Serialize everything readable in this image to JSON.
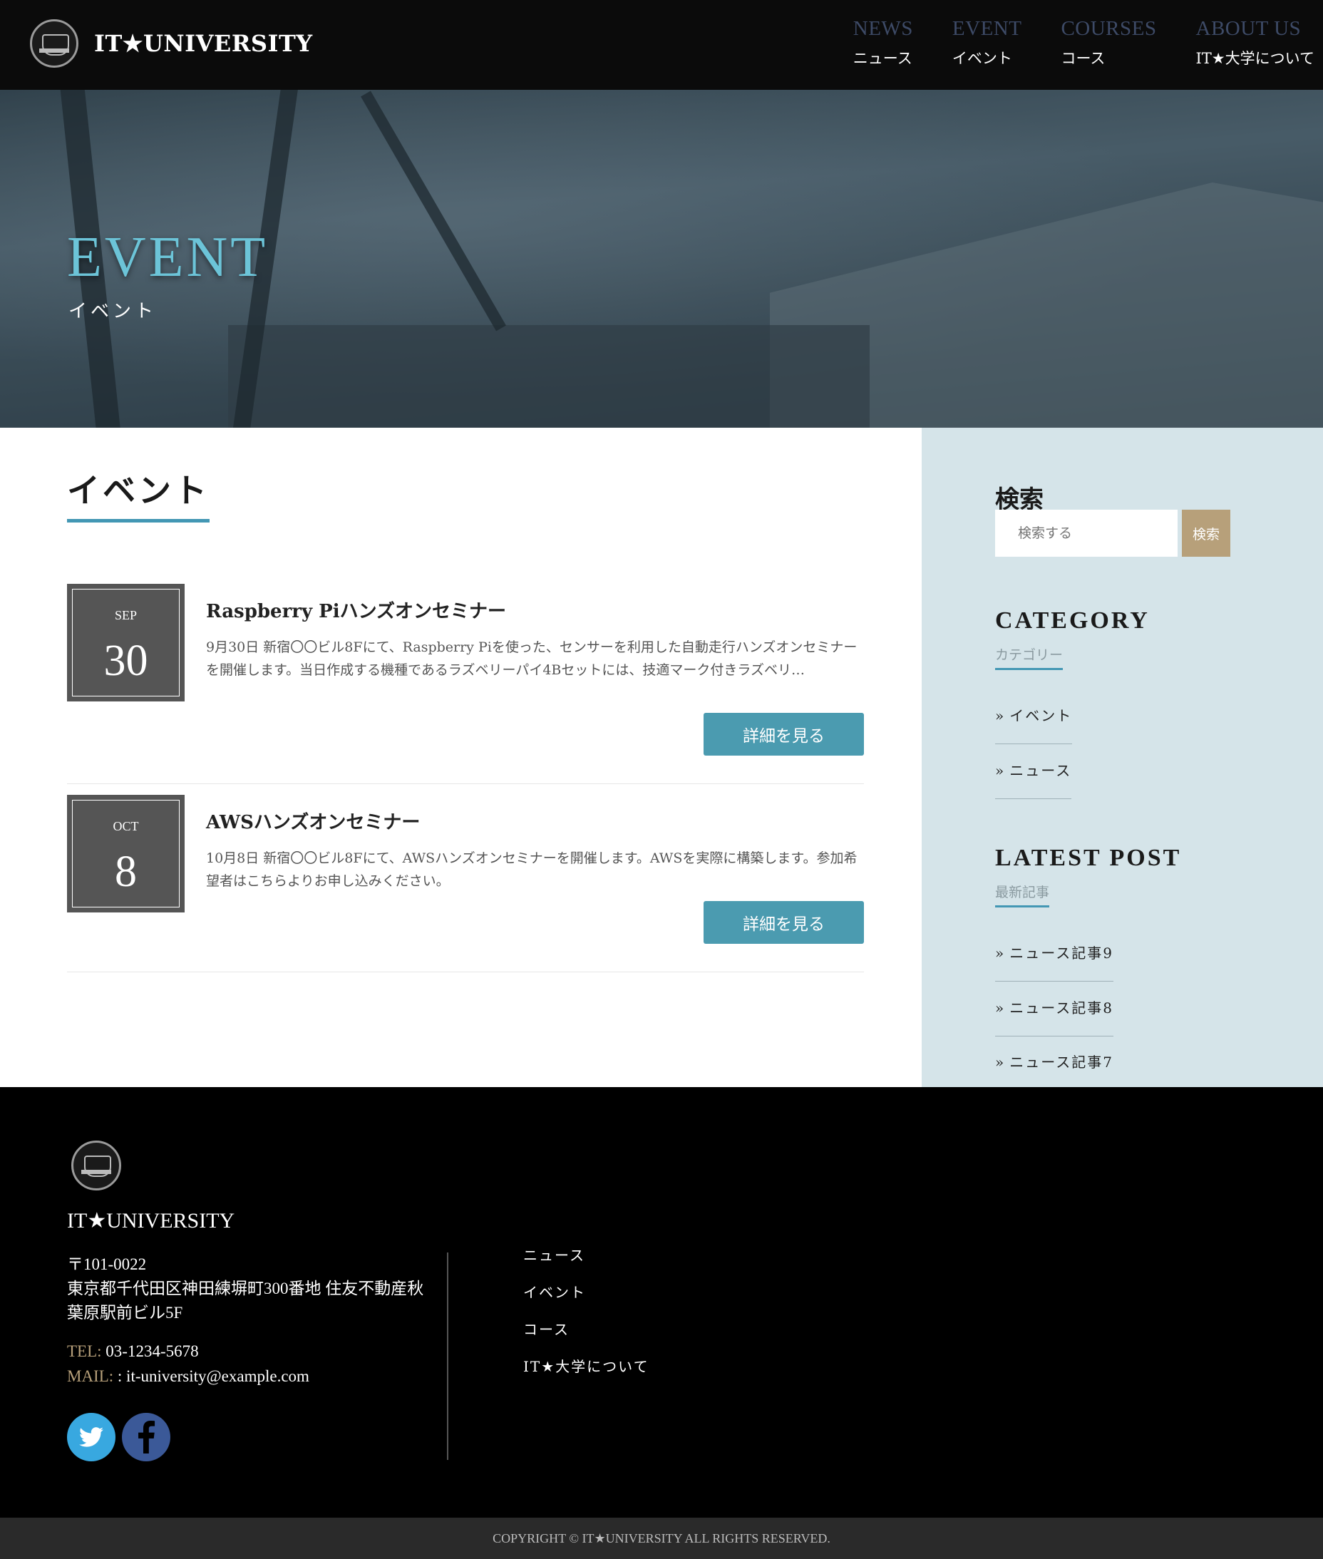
{
  "header": {
    "site_name": "IT★UNIVERSITY",
    "nav": [
      {
        "en": "NEWS",
        "ja": "ニュース"
      },
      {
        "en": "EVENT",
        "ja": "イベント"
      },
      {
        "en": "COURSES",
        "ja": "コース"
      },
      {
        "en": "ABOUT US",
        "ja": "IT★大学について"
      }
    ]
  },
  "hero": {
    "title": "EVENT",
    "subtitle": "イベント"
  },
  "main": {
    "heading": "イベント",
    "events": [
      {
        "month": "SEP",
        "day": "30",
        "title": "Raspberry Piハンズオンセミナー",
        "description": "9月30日 新宿〇〇ビル8Fにて、Raspberry Piを使った、センサーを利用した自動走行ハンズオンセミナーを開催します。当日作成する機種であるラズベリーパイ4Bセットには、技適マーク付きラズベリ…",
        "button": "詳細を見る"
      },
      {
        "month": "OCT",
        "day": "8",
        "title": "AWSハンズオンセミナー",
        "description": "10月8日 新宿〇〇ビル8Fにて、AWSハンズオンセミナーを開催します。AWSを実際に構築します。参加希望者はこちらよりお申し込みください。",
        "button": "詳細を見る"
      }
    ]
  },
  "sidebar": {
    "search_heading": "検索",
    "search_placeholder": "検索する",
    "search_button": "検索",
    "category_heading": "CATEGORY",
    "category_sub": "カテゴリー",
    "categories": [
      "イベント",
      "ニュース"
    ],
    "latest_heading": "LATEST POST",
    "latest_sub": "最新記事",
    "latest_posts": [
      "ニュース記事9",
      "ニュース記事8",
      "ニュース記事7"
    ]
  },
  "footer": {
    "site_name": "IT★UNIVERSITY",
    "postal": "〒101-0022",
    "address": "東京都千代田区神田練塀町300番地 住友不動産秋葉原駅前ビル5F",
    "tel_label": "TEL:",
    "tel": "03-1234-5678",
    "mail_label": "MAIL:",
    "mail": ": it-university@example.com",
    "nav": [
      "ニュース",
      "イベント",
      "コース",
      "IT★大学について"
    ],
    "copyright": "COPYRIGHT © IT★UNIVERSITY ALL RIGHTS RESERVED."
  },
  "colors": {
    "accent": "#4397b4",
    "button": "#4b9bb0",
    "search_button": "#b7a07a",
    "sidebar_bg": "#d5e4e9"
  }
}
